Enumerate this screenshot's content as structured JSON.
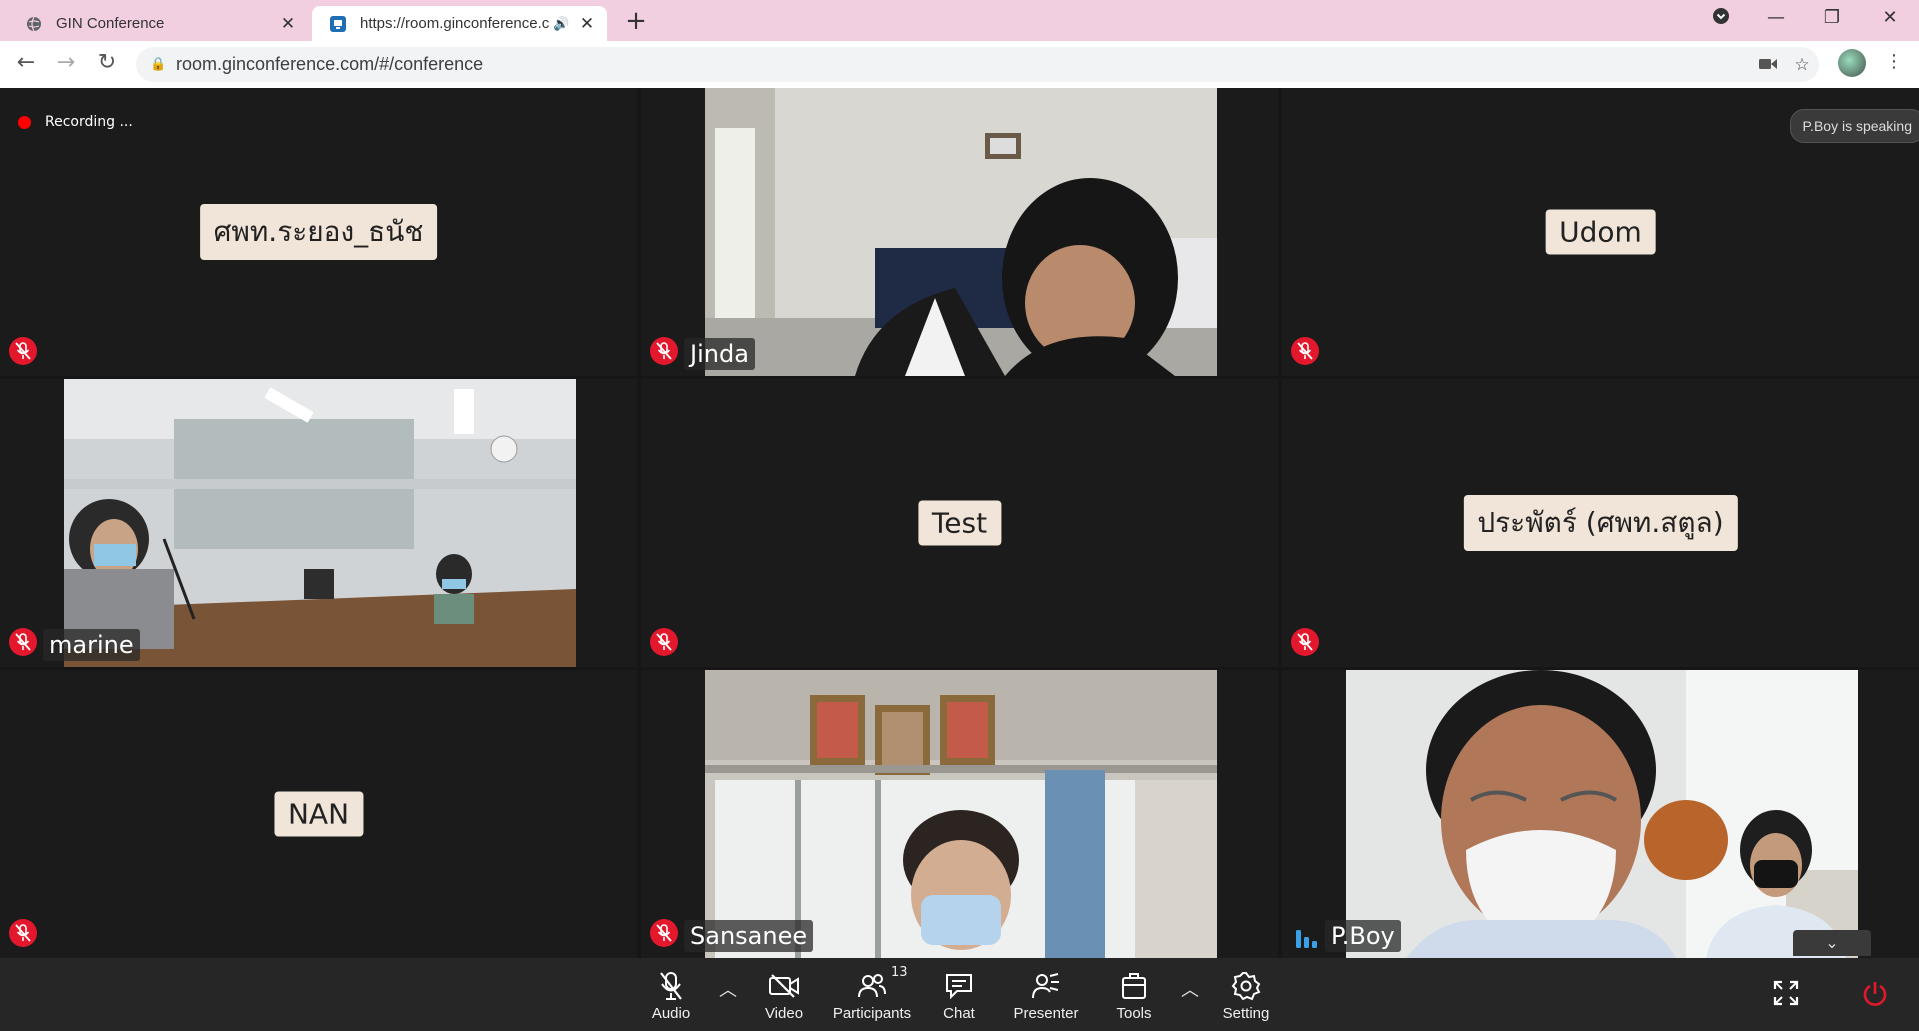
{
  "browser": {
    "tabs": [
      {
        "title": "GIN Conference",
        "close": "✕"
      },
      {
        "title": "https://room.ginconference.c",
        "close": "✕"
      }
    ],
    "new_tab": "+",
    "url": "room.ginconference.com/#/conference",
    "window_controls": {
      "minimize": "—",
      "restore": "❐",
      "close": "✕"
    }
  },
  "conference": {
    "recording_label": "Recording ...",
    "speaking_label": "P.Boy is speaking",
    "tiles": [
      {
        "name": "ศพท.ระยอง_ธนัช",
        "video": false,
        "mic": "muted"
      },
      {
        "name": "Jinda",
        "video": true,
        "mic": "muted"
      },
      {
        "name": "Udom",
        "video": false,
        "mic": "muted"
      },
      {
        "name": "marine",
        "video": true,
        "mic": "muted"
      },
      {
        "name": "Test",
        "video": false,
        "mic": "muted"
      },
      {
        "name": "ประพัตร์ (ศพท.สตูล)",
        "video": false,
        "mic": "muted"
      },
      {
        "name": "NAN",
        "video": false,
        "mic": "muted"
      },
      {
        "name": "Sansanee",
        "video": true,
        "mic": "muted"
      },
      {
        "name": "P.Boy",
        "video": true,
        "mic": "speaking"
      }
    ]
  },
  "controls": {
    "audio": "Audio",
    "video": "Video",
    "participants": "Participants",
    "participants_count": "13",
    "chat": "Chat",
    "presenter": "Presenter",
    "tools": "Tools",
    "setting": "Setting"
  },
  "colors": {
    "muted_mic": "#e3182d",
    "speaking": "#3aa0e8",
    "tab_strip": "#f2cfe0"
  }
}
